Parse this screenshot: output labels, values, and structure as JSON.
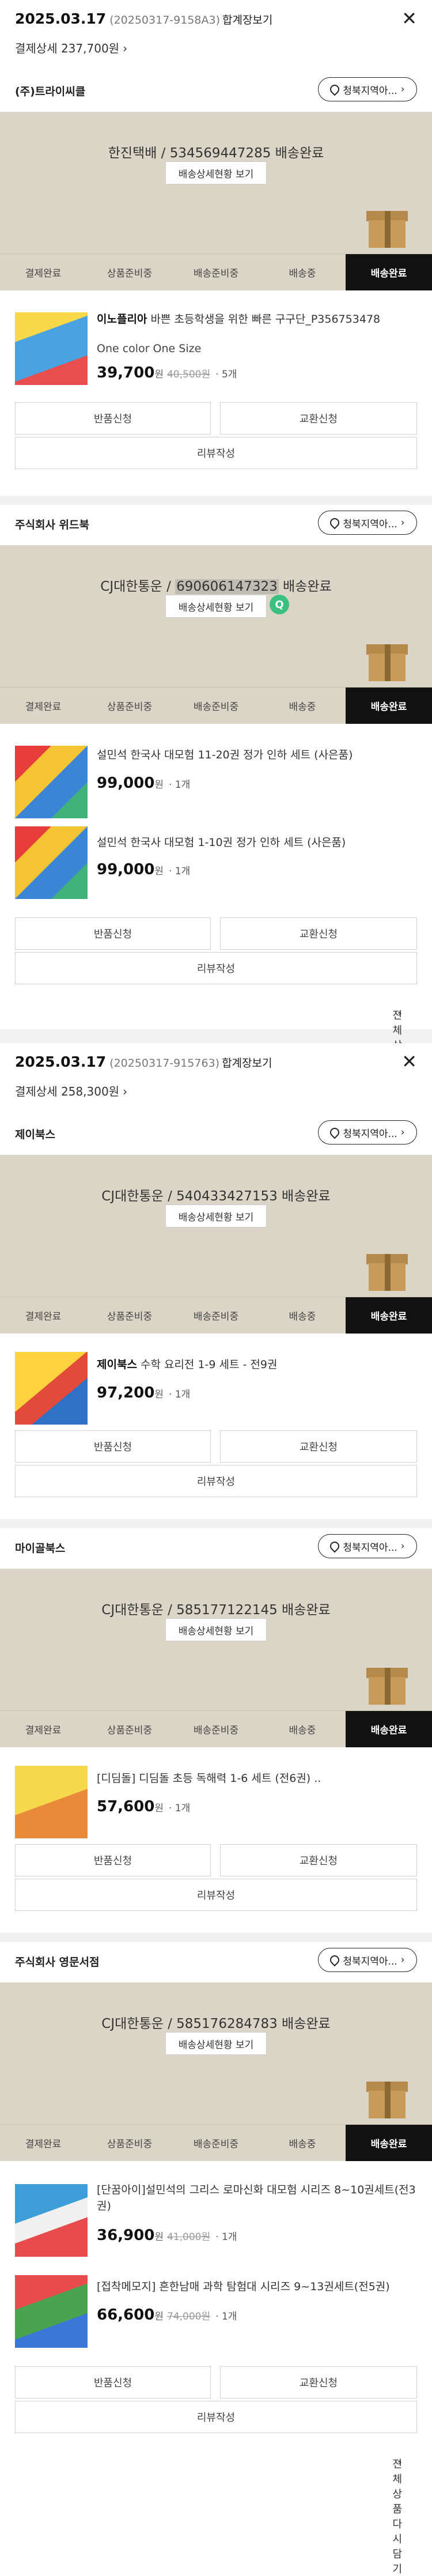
{
  "orders": [
    {
      "date": "2025.03.17",
      "order_no": "(20250317-9158A3)",
      "tag": "합계장보기",
      "detail_label": "결제상세 237,700원",
      "sellers": [
        {
          "name": "(주)트라이씨클",
          "region_btn": "청북지역아...",
          "courier": "한진택배 / 534569447285 배송완료",
          "track_btn": "배송상세현황 보기",
          "steps": [
            "결제완료",
            "상품준비중",
            "배송준비중",
            "배송중",
            "배송완료"
          ],
          "items": [
            {
              "brand": "이노플리아",
              "title": "바쁜 초등학생을 위한 빠른 구구단_P356753478",
              "option": "One color One Size",
              "price": "39,700",
              "won": "원",
              "orig": "40,500원",
              "qty": "· 5개"
            }
          ],
          "buttons": [
            "반품신청",
            "교환신청",
            "리뷰작성"
          ]
        }
      ]
    },
    {
      "sellers": [
        {
          "name": "주식회사 위드북",
          "region_btn": "청북지역아...",
          "courier_pre": "CJ대한통운 / ",
          "courier_hl": "690606147323",
          "courier_post": " 배송완료",
          "q_icon": "Q",
          "track_btn": "배송상세현황 보기",
          "steps": [
            "결제완료",
            "상품준비중",
            "배송준비중",
            "배송중",
            "배송완료"
          ],
          "items": [
            {
              "title": "설민석 한국사 대모험 11-20권 정가 인하 세트 (사은품)",
              "price": "99,000",
              "won": "원",
              "qty": "· 1개"
            },
            {
              "title": "설민석 한국사 대모험 1-10권 정가 인하 세트 (사은품)",
              "price": "99,000",
              "won": "원",
              "qty": "· 1개"
            }
          ],
          "buttons": [
            "반품신청",
            "교환신청",
            "리뷰작성"
          ],
          "reorder": "전체상품 다시담기"
        }
      ]
    },
    {
      "date": "2025.03.17",
      "order_no": "(20250317-915763)",
      "tag": "합계장보기",
      "detail_label": "결제상세 258,300원",
      "sellers": [
        {
          "name": "제이북스",
          "region_btn": "청북지역아...",
          "courier": "CJ대한통운 / 540433427153 배송완료",
          "track_btn": "배송상세현황 보기",
          "steps": [
            "결제완료",
            "상품준비중",
            "배송준비중",
            "배송중",
            "배송완료"
          ],
          "items": [
            {
              "brand": "제이북스",
              "title": "수학 요리전 1-9 세트 - 전9권",
              "price": "97,200",
              "won": "원",
              "qty": "· 1개"
            }
          ],
          "buttons": [
            "반품신청",
            "교환신청",
            "리뷰작성"
          ]
        },
        {
          "name": "마이골북스",
          "region_btn": "청북지역아...",
          "courier": "CJ대한통운 / 585177122145 배송완료",
          "track_btn": "배송상세현황 보기",
          "steps": [
            "결제완료",
            "상품준비중",
            "배송준비중",
            "배송중",
            "배송완료"
          ],
          "items": [
            {
              "title": "[디딤돌] 디딤돌 초등 독해력 1-6 세트 (전6권) ..",
              "price": "57,600",
              "won": "원",
              "qty": "· 1개"
            }
          ],
          "buttons": [
            "반품신청",
            "교환신청",
            "리뷰작성"
          ]
        },
        {
          "name": "주식회사 영문서점",
          "region_btn": "청북지역아...",
          "courier": "CJ대한통운 / 585176284783 배송완료",
          "track_btn": "배송상세현황 보기",
          "steps": [
            "결제완료",
            "상품준비중",
            "배송준비중",
            "배송중",
            "배송완료"
          ],
          "items": [
            {
              "title": "[단꿈아이]설민석의 그리스 로마신화 대모험 시리즈 8~10권세트(전3권)",
              "price": "36,900",
              "won": "원",
              "orig": "41,000원",
              "qty": "· 1개"
            },
            {
              "title": "[접착메모지] 흔한남매 과학 탐험대 시리즈 9~13권세트(전5권)",
              "price": "66,600",
              "won": "원",
              "orig": "74,000원",
              "qty": "· 1개"
            }
          ],
          "buttons": [
            "반품신청",
            "교환신청",
            "리뷰작성"
          ],
          "reorder": "전체상품 다시담기"
        }
      ]
    }
  ]
}
